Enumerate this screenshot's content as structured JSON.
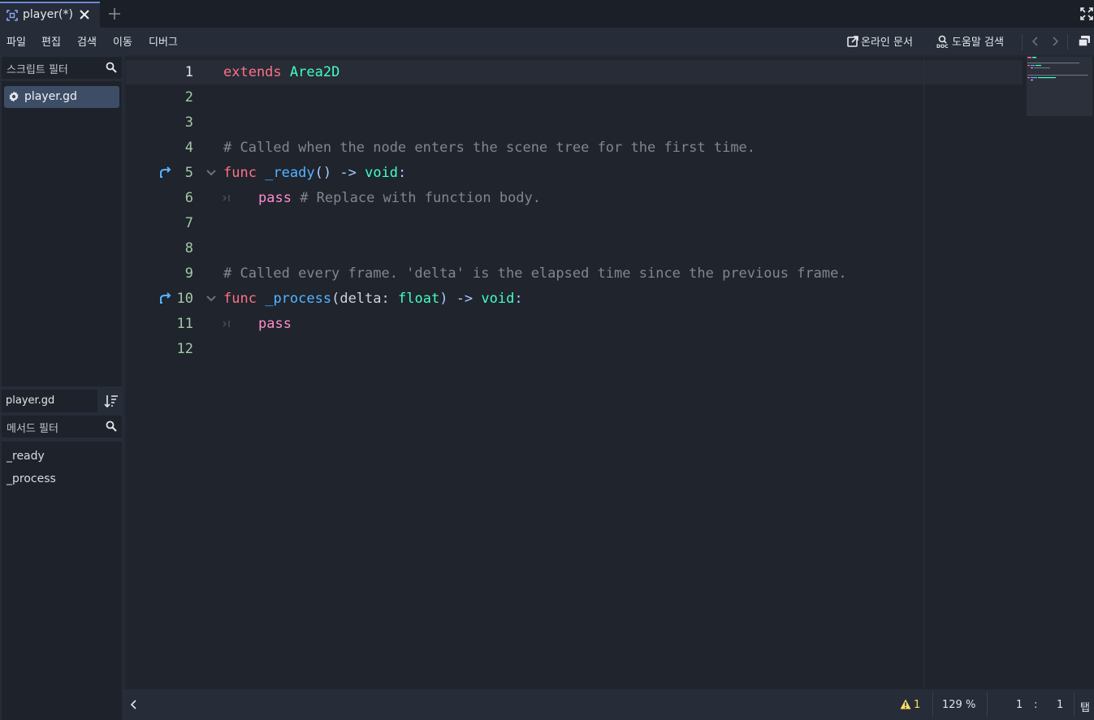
{
  "tab": {
    "label": "player(*)"
  },
  "menu": {
    "file": "파일",
    "edit": "편집",
    "search": "검색",
    "goto": "이동",
    "debug": "디버그"
  },
  "toolbar": {
    "online_docs": "온라인 문서",
    "help_search": "도움말 검색"
  },
  "sidebar": {
    "script_filter_placeholder": "스크립트 필터",
    "scripts": [
      "player.gd"
    ],
    "current_script": "player.gd",
    "method_filter_placeholder": "메서드 필터",
    "methods": [
      "_ready",
      "_process"
    ]
  },
  "editor": {
    "line_numbers": [
      "1",
      "2",
      "3",
      "4",
      "5",
      "6",
      "7",
      "8",
      "9",
      "10",
      "11",
      "12"
    ],
    "tokens": {
      "l1_kw": "extends",
      "l1_cls": "Area2D",
      "l4_comment": "# Called when the node enters the scene tree for the first time.",
      "l5_kw": "func",
      "l5_fn": "_ready",
      "l5_paren": "()",
      "l5_arrow": "->",
      "l5_ret": "void",
      "l5_colon": ":",
      "l6_pass": "pass",
      "l6_comment": "# Replace with function body.",
      "l9_comment": "# Called every frame. 'delta' is the elapsed time since the previous frame.",
      "l10_kw": "func",
      "l10_fn": "_process",
      "l10_open": "(delta:",
      "l10_type": "float",
      "l10_close": ")",
      "l10_arrow": "->",
      "l10_ret": "void",
      "l10_colon": ":",
      "l11_pass": "pass"
    }
  },
  "status": {
    "warnings": "1",
    "zoom": "129 %",
    "line": "1",
    "colon": ":",
    "column": "1",
    "indent": "탭"
  },
  "colors": {
    "keyword": "#ff7085",
    "class": "#42ffc2",
    "function": "#57b3ff",
    "control": "#ff8ccc",
    "comment": "#808791",
    "accent": "#6a8ad4",
    "warning": "#ffdd65"
  }
}
